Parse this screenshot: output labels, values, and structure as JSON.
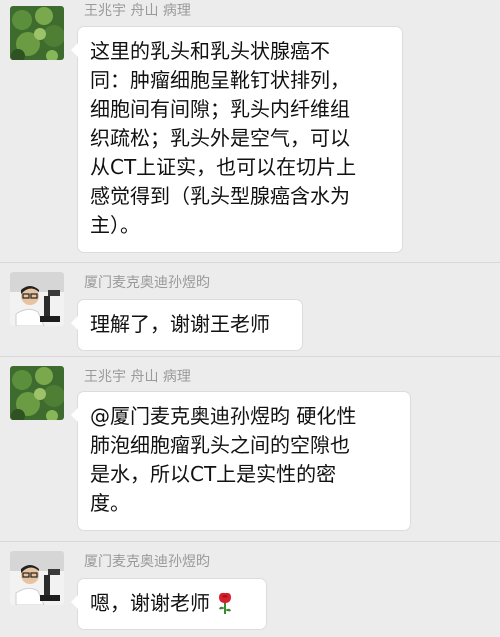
{
  "messages": [
    {
      "sender": "王兆宇 舟山 病理",
      "avatar_icon": "green-foliage-avatar-icon",
      "lines": [
        "这里的乳头和乳头状腺癌不",
        "同：肿瘤细胞呈靴钉状排列，",
        "细胞间有间隙；乳头内纤维组",
        "织疏松；乳头外是空气，可以",
        "从CT上证实，也可以在切片上",
        "感觉得到（乳头型腺癌含水为",
        "主）。"
      ]
    },
    {
      "sender": "厦门麦克奥迪孙煜昀",
      "avatar_icon": "man-with-glasses-at-microscope-avatar-icon",
      "lines": [
        "理解了，谢谢王老师"
      ]
    },
    {
      "sender": "王兆宇 舟山 病理",
      "avatar_icon": "green-foliage-avatar-icon",
      "lines": [
        "@厦门麦克奥迪孙煜昀  硬化性",
        "肺泡细胞瘤乳头之间的空隙也",
        "是水，所以CT上是实性的密",
        "度。"
      ]
    },
    {
      "sender": "厦门麦克奥迪孙煜昀",
      "avatar_icon": "man-with-glasses-at-microscope-avatar-icon",
      "lines": [
        "嗯，谢谢老师"
      ],
      "emoji": "rose-emoji-icon"
    }
  ]
}
